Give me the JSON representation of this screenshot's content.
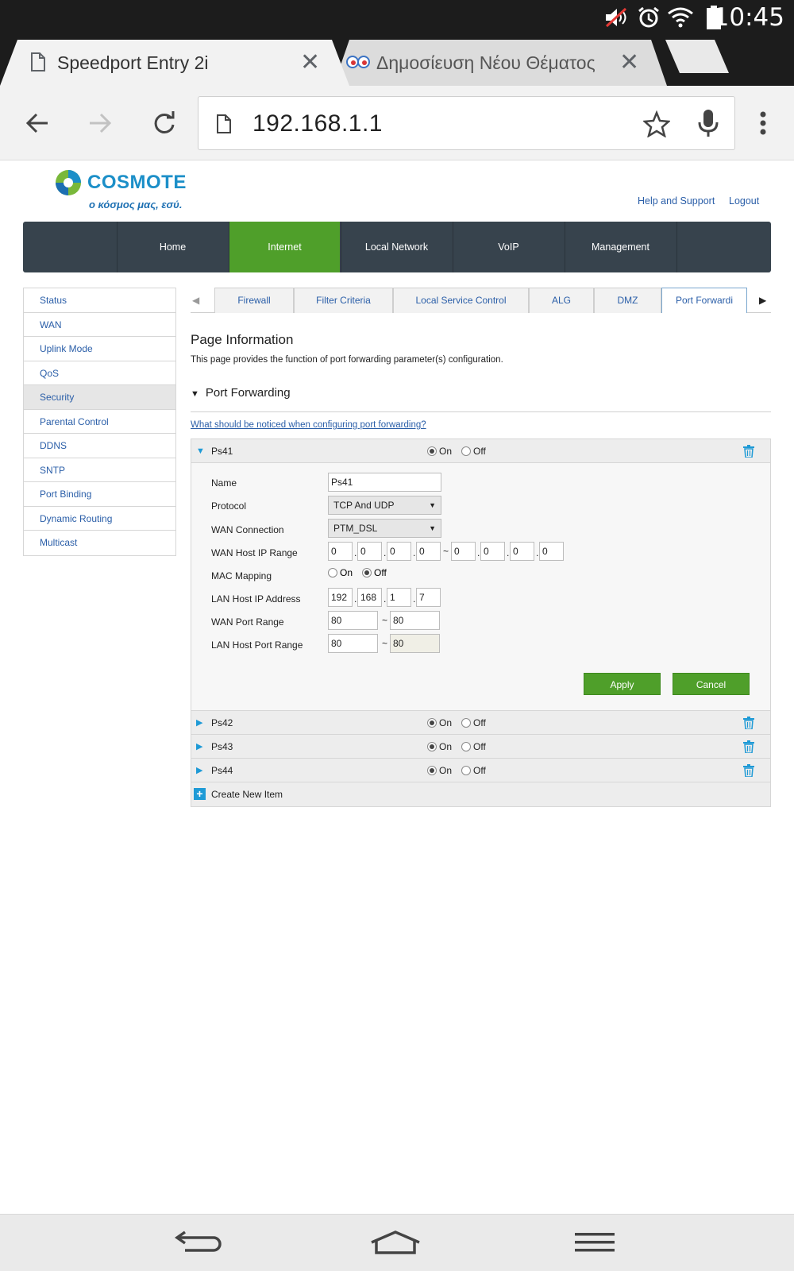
{
  "status_bar": {
    "time": "10:45",
    "icons": [
      "mute-icon",
      "alarm-icon",
      "wifi-icon",
      "battery-icon"
    ]
  },
  "browser": {
    "tabs": [
      {
        "title": "Speedport Entry 2i",
        "icon": "page-icon",
        "active": true
      },
      {
        "title": "Δημοσίευση Νέου Θέματος",
        "icon": "forum-favicon",
        "active": false
      }
    ],
    "url": "192.168.1.1"
  },
  "site": {
    "logo": {
      "name": "COSMOTE",
      "tagline": "ο κόσμος μας, εσύ."
    },
    "top_links": {
      "help": "Help and Support",
      "logout": "Logout"
    },
    "main_nav": [
      "Home",
      "Internet",
      "Local Network",
      "VoIP",
      "Management"
    ],
    "main_nav_active": "Internet",
    "sidebar": [
      "Status",
      "WAN",
      "Uplink Mode",
      "QoS",
      "Security",
      "Parental Control",
      "DDNS",
      "SNTP",
      "Port Binding",
      "Dynamic Routing",
      "Multicast"
    ],
    "sidebar_active": "Security",
    "sub_tabs": [
      "Firewall",
      "Filter Criteria",
      "Local Service Control",
      "ALG",
      "DMZ",
      "Port Forwardi"
    ],
    "sub_tab_active": "Port Forwardi"
  },
  "content": {
    "page_info_title": "Page Information",
    "page_info_desc": "This page provides the function of port forwarding parameter(s) configuration.",
    "section_title": "Port Forwarding",
    "help_link": "What should be noticed when configuring port forwarding?",
    "on_label": "On",
    "off_label": "Off",
    "expanded_rule": {
      "name": "Ps41",
      "enabled": true,
      "fields": {
        "name_label": "Name",
        "name_value": "Ps41",
        "protocol_label": "Protocol",
        "protocol_value": "TCP And UDP",
        "wan_conn_label": "WAN Connection",
        "wan_conn_value": "PTM_DSL",
        "wan_ip_label": "WAN Host IP Range",
        "wan_ip_start": [
          "0",
          "0",
          "0",
          "0"
        ],
        "wan_ip_end": [
          "0",
          "0",
          "0",
          "0"
        ],
        "mac_label": "MAC Mapping",
        "mac_value": "Off",
        "lan_ip_label": "LAN Host IP Address",
        "lan_ip": [
          "192",
          "168",
          "1",
          "7"
        ],
        "wan_port_label": "WAN Port Range",
        "wan_port_start": "80",
        "wan_port_end": "80",
        "lan_port_label": "LAN Host Port Range",
        "lan_port_start": "80",
        "lan_port_end": "80"
      },
      "apply_label": "Apply",
      "cancel_label": "Cancel"
    },
    "collapsed_rules": [
      {
        "name": "Ps42",
        "enabled": true
      },
      {
        "name": "Ps43",
        "enabled": true
      },
      {
        "name": "Ps44",
        "enabled": true
      }
    ],
    "create_label": "Create New Item"
  },
  "nav_bar": [
    "back-icon",
    "home-icon",
    "menu-icon"
  ],
  "colors": {
    "accent_green": "#4f9f2a",
    "nav_dark": "#37434d",
    "link_blue": "#2a5ea8",
    "icon_blue": "#1e9ad6"
  }
}
